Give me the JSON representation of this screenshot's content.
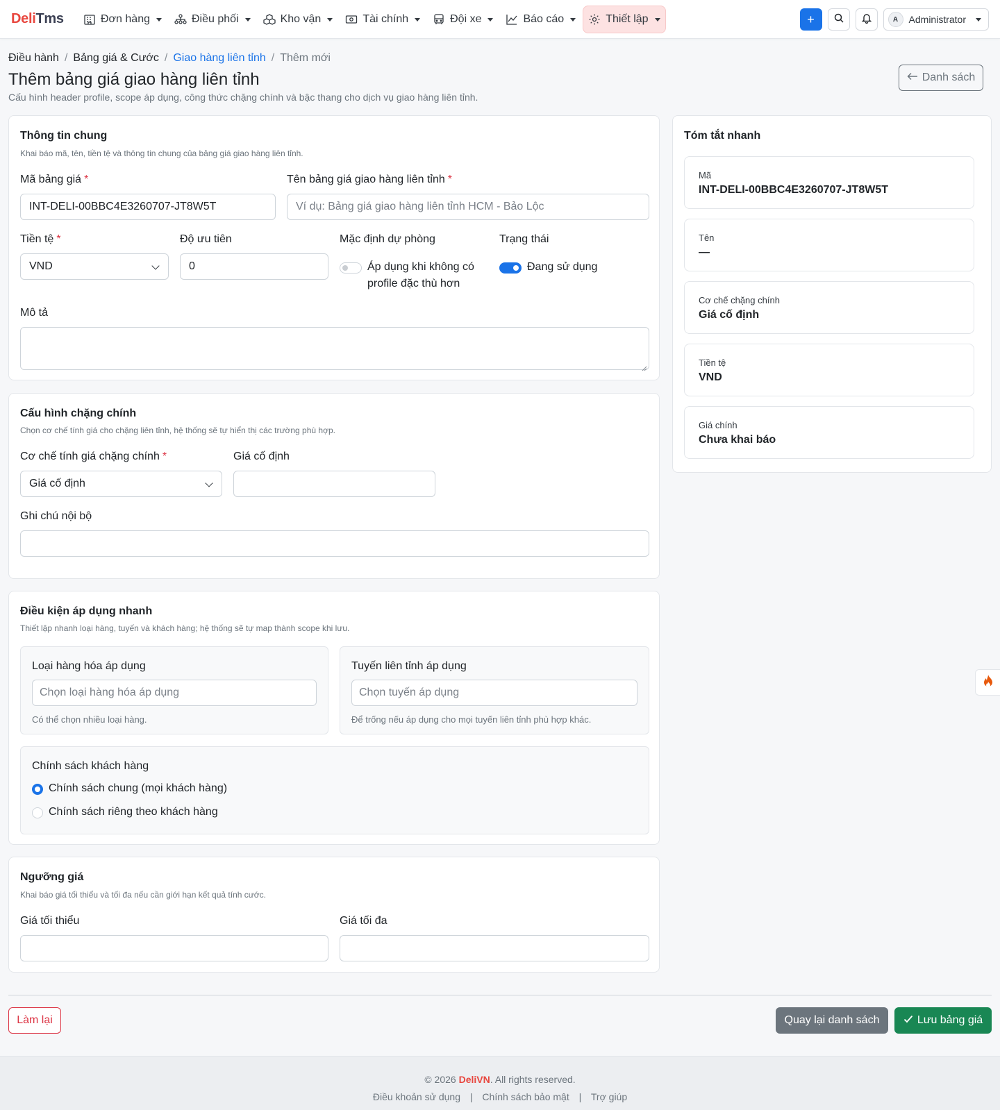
{
  "brand": {
    "part1": "Deli",
    "part2": "Tms"
  },
  "nav": {
    "items": [
      {
        "label": "Đơn hàng",
        "icon": "building-icon"
      },
      {
        "label": "Điều phối",
        "icon": "hierarchy-icon"
      },
      {
        "label": "Kho vận",
        "icon": "boxes-icon"
      },
      {
        "label": "Tài chính",
        "icon": "cash-icon"
      },
      {
        "label": "Đội xe",
        "icon": "bus-icon"
      },
      {
        "label": "Báo cáo",
        "icon": "chart-line-icon"
      },
      {
        "label": "Thiết lập",
        "icon": "gear-icon",
        "active": true
      }
    ],
    "add_symbol": "+",
    "user": {
      "initial": "A",
      "name": "Administrator"
    }
  },
  "breadcrumb": [
    "Điều hành",
    "Bảng giá & Cước",
    "Giao hàng liên tỉnh",
    "Thêm mới"
  ],
  "page": {
    "title": "Thêm bảng giá giao hàng liên tỉnh",
    "subtitle": "Cấu hình header profile, scope áp dụng, công thức chặng chính và bậc thang cho dịch vụ giao hàng liên tỉnh.",
    "back_label": "Danh sách"
  },
  "general": {
    "title": "Thông tin chung",
    "desc": "Khai báo mã, tên, tiền tệ và thông tin chung của bảng giá giao hàng liên tỉnh.",
    "code_label": "Mã bảng giá",
    "code_value": "INT-DELI-00BBC4E3260707-JT8W5T",
    "name_label": "Tên bảng giá giao hàng liên tỉnh",
    "name_placeholder": "Ví dụ: Bảng giá giao hàng liên tỉnh HCM - Bảo Lộc",
    "currency_label": "Tiền tệ",
    "currency_value": "VND",
    "priority_label": "Độ ưu tiên",
    "priority_value": "0",
    "fallback_label": "Mặc định dự phòng",
    "fallback_text": "Áp dụng khi không có profile đặc thù hơn",
    "fallback_on": false,
    "status_label": "Trạng thái",
    "status_text": "Đang sử dụng",
    "status_on": true,
    "desc_label": "Mô tả",
    "required_mark": "*"
  },
  "segment": {
    "title": "Cấu hình chặng chính",
    "desc": "Chọn cơ chế tính giá cho chặng liên tỉnh, hệ thống sẽ tự hiển thị các trường phù hợp.",
    "mechanism_label": "Cơ chế tính giá chặng chính",
    "mechanism_value": "Giá cố định",
    "fixed_price_label": "Giá cố định",
    "fixed_price_value": "",
    "note_label": "Ghi chú nội bộ",
    "note_value": ""
  },
  "conditions": {
    "title": "Điều kiện áp dụng nhanh",
    "desc": "Thiết lập nhanh loại hàng, tuyến và khách hàng; hệ thống sẽ tự map thành scope khi lưu.",
    "goods_label": "Loại hàng hóa áp dụng",
    "goods_placeholder": "Chọn loại hàng hóa áp dụng",
    "goods_help": "Có thể chọn nhiều loại hàng.",
    "route_label": "Tuyến liên tỉnh áp dụng",
    "route_placeholder": "Chọn tuyến áp dụng",
    "route_help": "Để trống nếu áp dụng cho mọi tuyến liên tỉnh phù hợp khác.",
    "policy_label": "Chính sách khách hàng",
    "policy_options": [
      "Chính sách chung (mọi khách hàng)",
      "Chính sách riêng theo khách hàng"
    ],
    "policy_selected": 0
  },
  "threshold": {
    "title": "Ngưỡng giá",
    "desc": "Khai báo giá tối thiểu và tối đa nếu cần giới hạn kết quả tính cước.",
    "min_label": "Giá tối thiểu",
    "max_label": "Giá tối đa"
  },
  "summary": {
    "title": "Tóm tắt nhanh",
    "items": [
      {
        "label": "Mã",
        "value": "INT-DELI-00BBC4E3260707-JT8W5T"
      },
      {
        "label": "Tên",
        "value": "—"
      },
      {
        "label": "Cơ chế chặng chính",
        "value": "Giá cố định"
      },
      {
        "label": "Tiền tệ",
        "value": "VND"
      },
      {
        "label": "Giá chính",
        "value": "Chưa khai báo"
      }
    ]
  },
  "actions": {
    "reset": "Làm lại",
    "back_list": "Quay lại danh sách",
    "save": "Lưu bảng giá"
  },
  "footer": {
    "copyright_prefix": "© 2026 ",
    "copyright_brand": "DeliVN",
    "copyright_suffix": ". All rights reserved.",
    "links": [
      "Điều khoản sử dụng",
      "Chính sách bảo mật",
      "Trợ giúp"
    ],
    "link_separator": "|"
  },
  "colors": {
    "primary": "#1a73e8",
    "danger": "#dc3545",
    "success": "#198754",
    "secondary": "#6c757d",
    "brand_red": "#e8473f",
    "active_menu_bg": "#fde2e2"
  }
}
